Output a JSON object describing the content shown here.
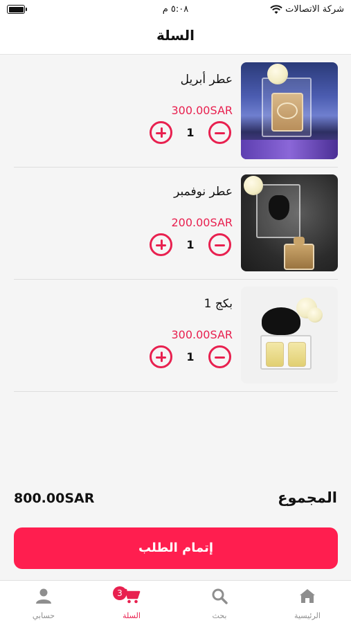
{
  "status_bar": {
    "carrier": "شركة الاتصالات",
    "time": "٥:٠٨ م"
  },
  "header": {
    "title": "السلة"
  },
  "cart": {
    "items": [
      {
        "name": "عطر أبريل",
        "price": "300.00SAR",
        "quantity": "1",
        "image": "perfume-april-photo"
      },
      {
        "name": "عطر نوفمبر",
        "price": "200.00SAR",
        "quantity": "1",
        "image": "perfume-november-photo"
      },
      {
        "name": "بكج 1",
        "price": "300.00SAR",
        "quantity": "1",
        "image": "package-1-photo"
      }
    ]
  },
  "summary": {
    "total_label": "المجموع",
    "total_value": "800.00SAR"
  },
  "checkout": {
    "label": "إتمام الطلب"
  },
  "tabbar": {
    "items": [
      {
        "label": "الرئيسية",
        "icon": "home-icon"
      },
      {
        "label": "بحث",
        "icon": "search-icon"
      },
      {
        "label": "السلة",
        "icon": "cart-icon",
        "badge": "3",
        "active": true
      },
      {
        "label": "حسابي",
        "icon": "person-icon"
      }
    ]
  },
  "colors": {
    "accent": "#e8204f",
    "button": "#ff1e4f",
    "background": "#f5f5f5"
  }
}
